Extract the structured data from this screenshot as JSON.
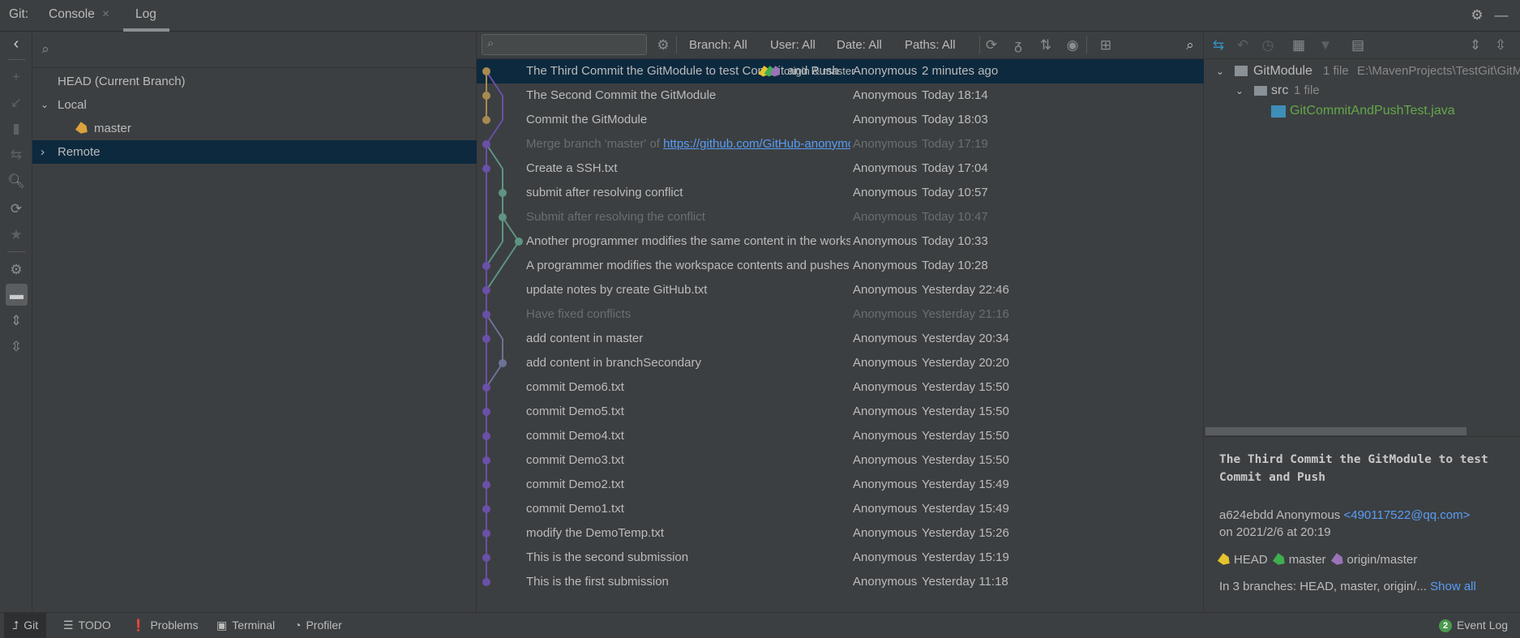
{
  "tabs": {
    "prefix": "Git:",
    "console": "Console",
    "close": "×",
    "log": "Log"
  },
  "branches_tree": {
    "head": "HEAD (Current Branch)",
    "local": "Local",
    "master": "master",
    "remote": "Remote"
  },
  "log_toolbar": {
    "branch": "Branch: All",
    "user": "User: All",
    "date": "Date: All",
    "paths": "Paths: All",
    "search_placeholder": ""
  },
  "commits": [
    {
      "subject": "The Third Commit the GitModule to test Commit and Push",
      "refs": "origin & master",
      "author": "Anonymous",
      "date": "2 minutes ago",
      "selected": true
    },
    {
      "subject": "The Second Commit the GitModule",
      "author": "Anonymous",
      "date": "Today 18:14"
    },
    {
      "subject": "Commit the GitModule",
      "author": "Anonymous",
      "date": "Today 18:03"
    },
    {
      "subject": "Merge branch 'master' of ",
      "link": "https://github.com/GitHub-anonymousV/Notes",
      "author": "Anonymous",
      "date": "Today 17:19",
      "dim": true
    },
    {
      "subject": "Create a SSH.txt",
      "author": "Anonymous",
      "date": "Today 17:04"
    },
    {
      "subject": "submit after resolving conflict",
      "author": "Anonymous",
      "date": "Today 10:57"
    },
    {
      "subject": "Submit after resolving the conflict",
      "author": "Anonymous",
      "date": "Today 10:47",
      "dim": true
    },
    {
      "subject": "Another programmer modifies the same content in the workspace and pushes data",
      "author": "Anonymous",
      "date": "Today 10:33"
    },
    {
      "subject": "A programmer modifies the workspace contents and pushes data to the remote repository",
      "author": "Anonymous",
      "date": "Today 10:28"
    },
    {
      "subject": "update notes by create GitHub.txt",
      "author": "Anonymous",
      "date": "Yesterday 22:46"
    },
    {
      "subject": "Have fixed conflicts",
      "author": "Anonymous",
      "date": "Yesterday 21:16",
      "dim": true
    },
    {
      "subject": "add content in master",
      "author": "Anonymous",
      "date": "Yesterday 20:34"
    },
    {
      "subject": "add content in branchSecondary",
      "author": "Anonymous",
      "date": "Yesterday 20:20"
    },
    {
      "subject": "commit Demo6.txt",
      "author": "Anonymous",
      "date": "Yesterday 15:50"
    },
    {
      "subject": "commit Demo5.txt",
      "author": "Anonymous",
      "date": "Yesterday 15:50"
    },
    {
      "subject": "commit Demo4.txt",
      "author": "Anonymous",
      "date": "Yesterday 15:50"
    },
    {
      "subject": "commit Demo3.txt",
      "author": "Anonymous",
      "date": "Yesterday 15:50"
    },
    {
      "subject": "commit Demo2.txt",
      "author": "Anonymous",
      "date": "Yesterday 15:49"
    },
    {
      "subject": "commit Demo1.txt",
      "author": "Anonymous",
      "date": "Yesterday 15:49"
    },
    {
      "subject": "modify the DemoTemp.txt",
      "author": "Anonymous",
      "date": "Yesterday 15:26"
    },
    {
      "subject": "This is the second submission",
      "author": "Anonymous",
      "date": "Yesterday 15:19"
    },
    {
      "subject": "This is the first submission",
      "author": "Anonymous",
      "date": "Yesterday 11:18"
    }
  ],
  "changes": {
    "module": "GitModule",
    "module_count": "1 file",
    "module_path": "E:\\MavenProjects\\TestGit\\GitModule",
    "src": "src",
    "src_count": "1 file",
    "file": "GitCommitAndPushTest.java"
  },
  "details": {
    "title": "The Third Commit the GitModule to test Commit and Push",
    "hash_author": "a624ebdd Anonymous ",
    "email": "<490117522@qq.com>",
    "date": "on 2021/2/6 at 20:19",
    "tags": [
      {
        "name": "HEAD",
        "color": "#e5c32c"
      },
      {
        "name": "master",
        "color": "#3fae4f"
      },
      {
        "name": "origin/master",
        "color": "#9a73b8"
      }
    ],
    "branches": "In 3 branches: HEAD, master, origin/...",
    "show_all": "Show all"
  },
  "status_bar": {
    "git": "Git",
    "todo": "TODO",
    "problems": "Problems",
    "terminal": "Terminal",
    "profiler": "Profiler",
    "event_count": "2",
    "event_log": "Event Log"
  },
  "colors": {
    "selection": "#0d293e",
    "link": "#589df6",
    "graph_gold": "#a88a50",
    "graph_purple": "#6a50a8",
    "graph_teal": "#5f9484",
    "graph_slate": "#6c7396",
    "added_file": "#62a84a"
  }
}
